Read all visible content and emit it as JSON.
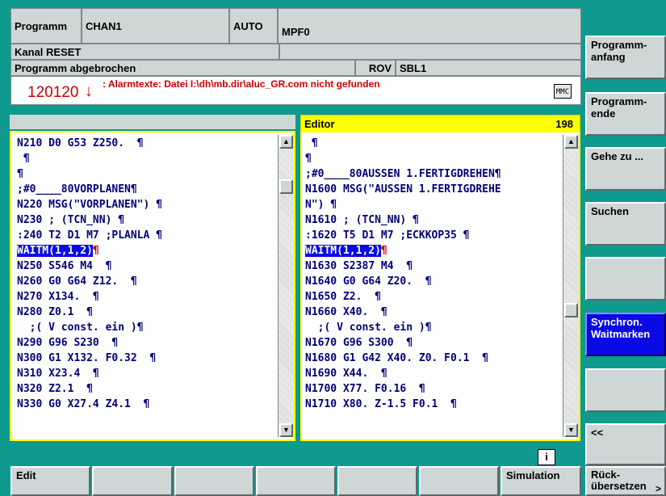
{
  "header": {
    "area": "Programm",
    "channel": "CHAN1",
    "mode": "AUTO",
    "program": "MPF0",
    "channel_status": "Kanal RESET",
    "program_status": "Programm abgebrochen",
    "rov": "ROV",
    "sbl": "SBL1"
  },
  "alarm": {
    "number": "120120",
    "arrow": "↓",
    "text": ": Alarmtexte: Datei I:\\dh\\mb.dir\\aluc_GR.com nicht gefunden",
    "mmc_label": "MMC"
  },
  "editor_right": {
    "title": "Editor",
    "count": "198"
  },
  "left_lines": [
    {
      "t": "N210 D0 G53 Z250.  ¶"
    },
    {
      "t": " ¶"
    },
    {
      "t": "¶"
    },
    {
      "t": ";#0____80VORPLANEN¶"
    },
    {
      "t": "N220 MSG(\"VORPLANEN\") ¶"
    },
    {
      "t": "N230 ; (TCN_NN) ¶"
    },
    {
      "t": ":240 T2 D1 M7 ;PLANLA ¶"
    },
    {
      "t": "WAITM(1,1,2)",
      "hl": true,
      "p": "¶"
    },
    {
      "t": "N250 S546 M4  ¶"
    },
    {
      "t": "N260 G0 G64 Z12.  ¶"
    },
    {
      "t": "N270 X134.  ¶"
    },
    {
      "t": "N280 Z0.1  ¶"
    },
    {
      "t": "  ;( V const. ein )¶"
    },
    {
      "t": "N290 G96 S230  ¶"
    },
    {
      "t": "N300 G1 X132. F0.32  ¶"
    },
    {
      "t": "N310 X23.4  ¶"
    },
    {
      "t": "N320 Z2.1  ¶"
    },
    {
      "t": "N330 G0 X27.4 Z4.1  ¶"
    }
  ],
  "right_lines": [
    {
      "t": " ¶"
    },
    {
      "t": "¶"
    },
    {
      "t": ";#0____80AUSSEN 1.FERTIGDREHEN¶"
    },
    {
      "t": "N1600 MSG(\"AUSSEN 1.FERTIGDREHE"
    },
    {
      "t": "N\") ¶"
    },
    {
      "t": "N1610 ; (TCN_NN) ¶"
    },
    {
      "t": ":1620 T5 D1 M7 ;ECKKOP35 ¶"
    },
    {
      "t": "WAITM(1,1,2)",
      "hl": true,
      "p": "¶"
    },
    {
      "t": "N1630 S2387 M4  ¶"
    },
    {
      "t": "N1640 G0 G64 Z20.  ¶"
    },
    {
      "t": "N1650 Z2.  ¶"
    },
    {
      "t": "N1660 X40.  ¶"
    },
    {
      "t": "  ;( V const. ein )¶"
    },
    {
      "t": "N1670 G96 S300  ¶"
    },
    {
      "t": "N1680 G1 G42 X40. Z0. F0.1  ¶"
    },
    {
      "t": "N1690 X44.  ¶"
    },
    {
      "t": "N1700 X77. F0.16  ¶"
    },
    {
      "t": "N1710 X80. Z-1.5 F0.1  ¶"
    }
  ],
  "vsoftkeys": [
    {
      "label": "Programm-\nanfang"
    },
    {
      "label": "Programm-\nende"
    },
    {
      "label": "Gehe zu ..."
    },
    {
      "label": "Suchen"
    },
    {
      "label": ""
    },
    {
      "label": "Synchron.\nWaitmarken",
      "active": true
    },
    {
      "label": ""
    },
    {
      "label": "<<"
    }
  ],
  "hsoftkeys": [
    {
      "label": "Edit"
    },
    {
      "label": ""
    },
    {
      "label": ""
    },
    {
      "label": ""
    },
    {
      "label": ""
    },
    {
      "label": ""
    },
    {
      "label": "Simulation"
    },
    {
      "label": "Rück-\nübersetzen"
    }
  ],
  "info_icon": "i",
  "extend_icon": ">"
}
